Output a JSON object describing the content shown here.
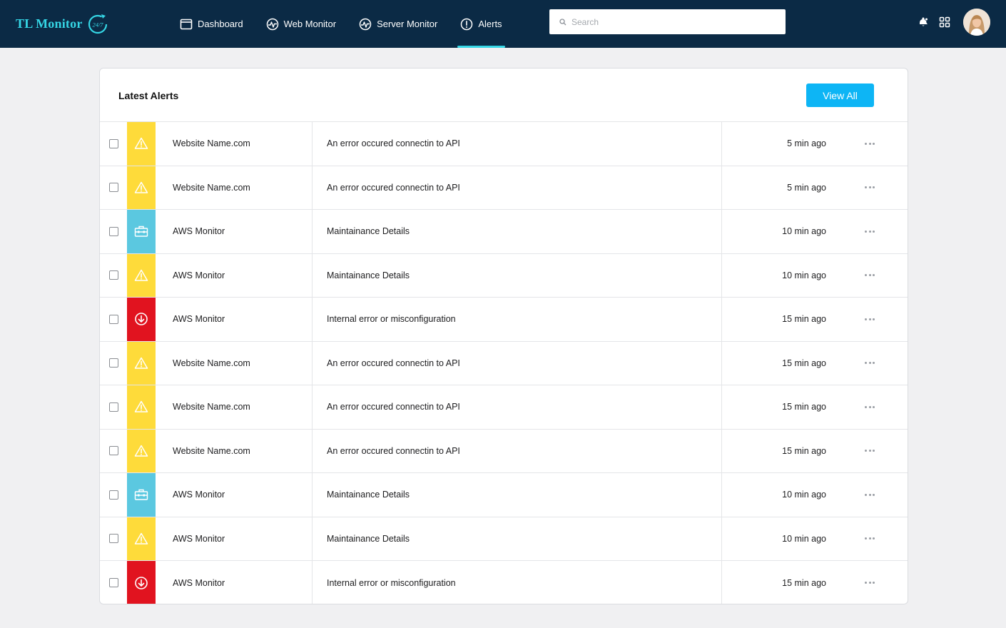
{
  "app": {
    "logo_text": "TL Monitor",
    "logo_badge": "24/7",
    "brand_color": "#35d6e5",
    "header_color": "#0b2a45"
  },
  "nav": [
    {
      "label": "Dashboard",
      "icon": "dashboard-icon",
      "active": false
    },
    {
      "label": "Web Monitor",
      "icon": "web-monitor-icon",
      "active": false
    },
    {
      "label": "Server Monitor",
      "icon": "server-monitor-icon",
      "active": false
    },
    {
      "label": "Alerts",
      "icon": "alert-circle-icon",
      "active": true
    }
  ],
  "search": {
    "placeholder": "Search",
    "value": ""
  },
  "header_icons": [
    "notifications-icon",
    "apps-grid-icon"
  ],
  "card": {
    "title": "Latest Alerts",
    "view_all_label": "View All",
    "accent_color": "#0db5f5"
  },
  "severity_colors": {
    "warning": "#fedb3a",
    "maintenance": "#5bc8e0",
    "error": "#e1131f"
  },
  "alerts": [
    {
      "severity": "warning",
      "icon": "warning-triangle-icon",
      "source": "Website Name.com",
      "message": "An error occured connectin to API",
      "time": "5 min ago"
    },
    {
      "severity": "warning",
      "icon": "warning-triangle-icon",
      "source": "Website Name.com",
      "message": "An error occured connectin to API",
      "time": "5 min ago"
    },
    {
      "severity": "maintenance",
      "icon": "toolbox-icon",
      "source": "AWS Monitor",
      "message": "Maintainance Details",
      "time": "10 min ago"
    },
    {
      "severity": "warning",
      "icon": "warning-triangle-icon",
      "source": "AWS Monitor",
      "message": "Maintainance Details",
      "time": "10 min ago"
    },
    {
      "severity": "error",
      "icon": "down-arrow-circle-icon",
      "source": "AWS Monitor",
      "message": "Internal error or misconfiguration",
      "time": "15 min ago"
    },
    {
      "severity": "warning",
      "icon": "warning-triangle-icon",
      "source": "Website Name.com",
      "message": "An error occured connectin to API",
      "time": "15 min ago"
    },
    {
      "severity": "warning",
      "icon": "warning-triangle-icon",
      "source": "Website Name.com",
      "message": "An error occured connectin to API",
      "time": "15 min ago"
    },
    {
      "severity": "warning",
      "icon": "warning-triangle-icon",
      "source": "Website Name.com",
      "message": "An error occured connectin to API",
      "time": "15 min ago"
    },
    {
      "severity": "maintenance",
      "icon": "toolbox-icon",
      "source": "AWS Monitor",
      "message": "Maintainance Details",
      "time": "10 min ago"
    },
    {
      "severity": "warning",
      "icon": "warning-triangle-icon",
      "source": "AWS Monitor",
      "message": "Maintainance Details",
      "time": "10 min ago"
    },
    {
      "severity": "error",
      "icon": "down-arrow-circle-icon",
      "source": "AWS Monitor",
      "message": "Internal error or misconfiguration",
      "time": "15 min ago"
    }
  ]
}
